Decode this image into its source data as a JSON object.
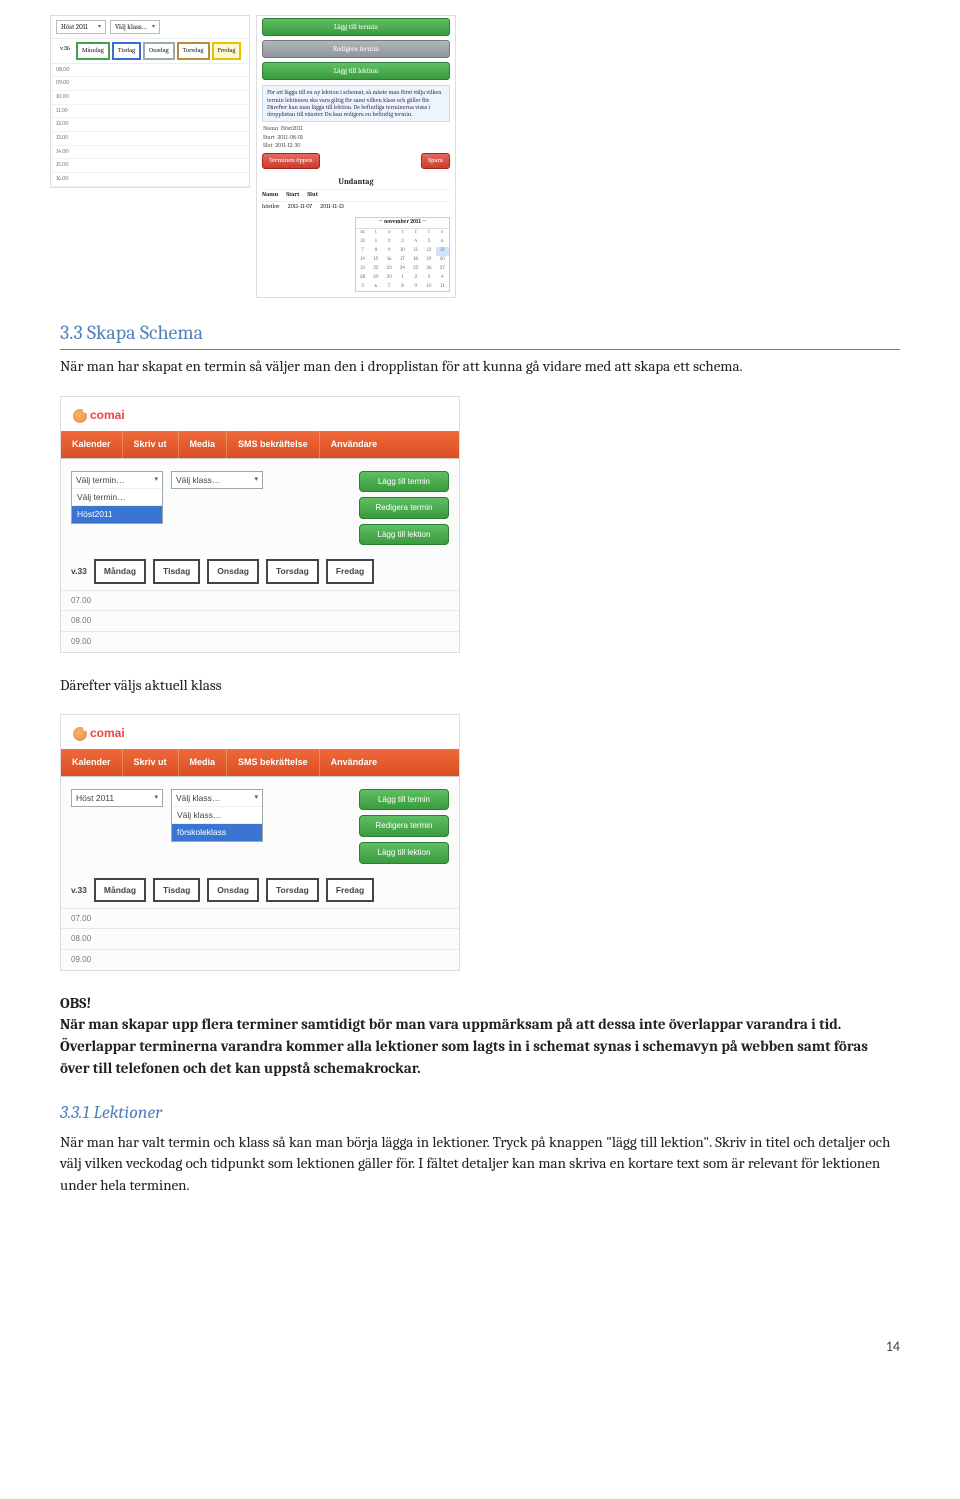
{
  "top_shot": {
    "term": "Höst 2011",
    "klass": "Välj klass…",
    "week": "v.36",
    "days": [
      "Måndag",
      "Tisdag",
      "Onsdag",
      "Torsdag",
      "Fredag"
    ],
    "times": [
      "08.00",
      "09.00",
      "10.00",
      "11.00",
      "12.00",
      "13.00",
      "14.00",
      "15.00",
      "16.00"
    ],
    "btn_add_term": "Lägg till termin",
    "btn_edit_term": "Redigera termin",
    "btn_add_lesson": "Lägg till lektion",
    "info_note": "För att lägga till en ny lektion i schemat, så måste man först välja vilken termin lektionen ska vara giltig för samt vilken klass och gäller för. Därefter kan man lägga till lektion. De befintliga terminerna visas i dropplistan till vänster. Du kan redigera en befintlig termin.",
    "kv_name_label": "Namn",
    "kv_name": "Höst2011",
    "kv_start_label": "Start",
    "kv_start": "2011-08-01",
    "kv_end_label": "Slut",
    "kv_end": "2011-12-30",
    "exc_title": "Undantag",
    "exc_hdr_name": "Namn",
    "exc_hdr_start": "Start",
    "exc_hdr_end": "Slut",
    "exc_row_name": "höstlov",
    "exc_row_start": "2011-11-07",
    "exc_row_end": "2011-11-13",
    "btn_save": "Spara",
    "term_toggle": "Terminen öppen",
    "cal_title": "← november 2011 →",
    "cal_dow": [
      "m",
      "t",
      "o",
      "t",
      "f",
      "l",
      "s"
    ],
    "cal_rows": [
      [
        "31",
        "1",
        "2",
        "3",
        "4",
        "5",
        "6"
      ],
      [
        "7",
        "8",
        "9",
        "10",
        "11",
        "12",
        "13"
      ],
      [
        "14",
        "15",
        "16",
        "17",
        "18",
        "19",
        "20"
      ],
      [
        "21",
        "22",
        "23",
        "24",
        "25",
        "26",
        "27"
      ],
      [
        "28",
        "29",
        "30",
        "1",
        "2",
        "3",
        "4"
      ],
      [
        "5",
        "6",
        "7",
        "8",
        "9",
        "10",
        "11"
      ]
    ]
  },
  "heading_33": "3.3 Skapa Schema",
  "p_33": "När man har skapat en termin så väljer man den i dropplistan för att kunna gå vidare med att skapa ett schema.",
  "app": {
    "brand": "comai",
    "nav": [
      "Kalender",
      "Skriv ut",
      "Media",
      "SMS bekräftelse",
      "Användare"
    ],
    "sel_term_placeholder": "Välj termin…",
    "sel_term_opt1": "Välj termin…",
    "sel_term_opt2": "Höst2011",
    "sel_klass_placeholder": "Välj klass…",
    "sel_klass_opt1": "Välj klass…",
    "sel_klass_opt2": "förskoleklass",
    "term_selected": "Höst 2011",
    "btn_add_term": "Lägg till termin",
    "btn_edit_term": "Redigera termin",
    "btn_add_lesson": "Lägg till lektion",
    "week": "v.33",
    "days": [
      "Måndag",
      "Tisdag",
      "Onsdag",
      "Torsdag",
      "Fredag"
    ],
    "times_a": [
      "07.00",
      "08.00",
      "09.00"
    ],
    "times_b": [
      "07.00",
      "08.00",
      "09.00"
    ]
  },
  "p_after_shot2": "Därefter väljs aktuell klass",
  "obs_label": "OBS!",
  "obs_text": "När man skapar upp flera terminer samtidigt bör man vara uppmärksam på att dessa inte överlappar varandra i tid. Överlappar terminerna varandra kommer alla lektioner som lagts in i schemat synas i schemavyn på webben samt föras över till telefonen och det kan uppstå schemakrockar.",
  "heading_331": "3.3.1 Lektioner",
  "p_331": "När man har valt termin och klass så kan man börja lägga in lektioner. Tryck på knappen \"lägg till lektion\". Skriv in titel och detaljer och välj vilken veckodag och tidpunkt som lektionen gäller för. I fältet detaljer kan man skriva en kortare text som är relevant för lektionen under hela terminen.",
  "page_number": "14"
}
